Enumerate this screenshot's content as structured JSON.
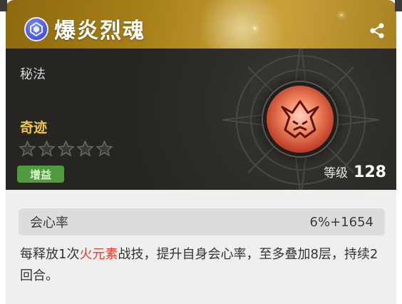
{
  "card": {
    "title": "爆炎烈魂",
    "category": "秘法",
    "rarity": "奇迹",
    "stars_total": 5,
    "stars_filled": 0,
    "tag": "增益",
    "level_label": "等级",
    "level_value": "128"
  },
  "stat": {
    "name": "会心率",
    "value": "6%+1654"
  },
  "description": {
    "part1": "每释放1次",
    "highlight": "火元素",
    "part2": "战技，提升自身会心率，至多叠加8层，持续2回合。"
  },
  "colors": {
    "header_gold": "#a77f17",
    "rarity_gold": "#f0c64a",
    "tag_green": "#4f9b3e",
    "highlight_red": "#e2402a"
  },
  "icons": {
    "emblem": "blue-crest-icon",
    "share": "share-icon",
    "skill": "flame-demon-icon",
    "star": "star-outline-icon"
  }
}
